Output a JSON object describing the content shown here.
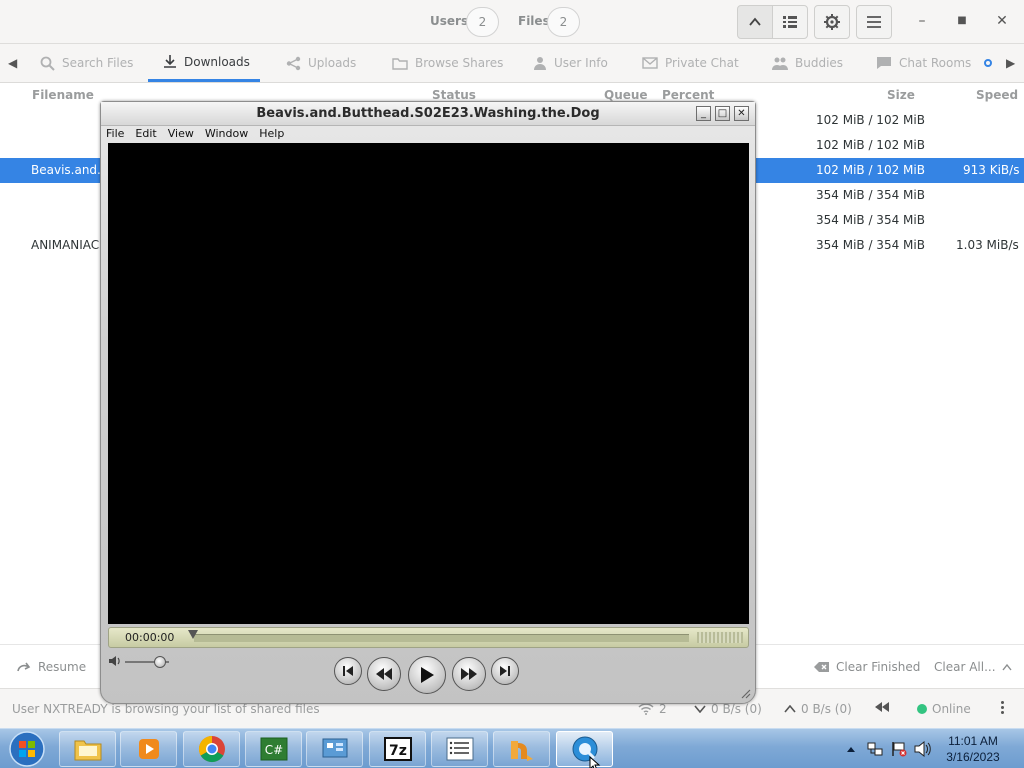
{
  "header": {
    "users_label": "Users",
    "users_count": "2",
    "files_label": "Files",
    "files_count": "2"
  },
  "tabs": [
    {
      "label": "Search Files",
      "icon": "search-icon"
    },
    {
      "label": "Downloads",
      "icon": "download-icon"
    },
    {
      "label": "Uploads",
      "icon": "share-icon"
    },
    {
      "label": "Browse Shares",
      "icon": "folder-icon"
    },
    {
      "label": "User Info",
      "icon": "user-icon"
    },
    {
      "label": "Private Chat",
      "icon": "mail-icon"
    },
    {
      "label": "Buddies",
      "icon": "people-icon"
    },
    {
      "label": "Chat Rooms",
      "icon": "chat-icon"
    }
  ],
  "columns": {
    "filename": "Filename",
    "status": "Status",
    "queue": "Queue",
    "percent": "Percent",
    "size": "Size",
    "speed": "Speed"
  },
  "transfers": [
    {
      "filename": "",
      "size": "102 MiB / 102 MiB",
      "speed": ""
    },
    {
      "filename": "",
      "size": "102 MiB / 102 MiB",
      "speed": ""
    },
    {
      "filename": "Beavis.and.Bu",
      "size": "102 MiB / 102 MiB",
      "speed": "913 KiB/s"
    },
    {
      "filename": "",
      "size": "354 MiB / 354 MiB",
      "speed": ""
    },
    {
      "filename": "",
      "size": "354 MiB / 354 MiB",
      "speed": ""
    },
    {
      "filename": "ANIMANIACS",
      "size": "354 MiB / 354 MiB",
      "speed": "1.03 MiB/s"
    }
  ],
  "bottom": {
    "resume": "Resume",
    "clear_finished": "Clear Finished",
    "clear_all": "Clear All..."
  },
  "status": {
    "message": "User NXTREADY is browsing your list of shared files",
    "connections": "2",
    "download_speed": "0 B/s (0)",
    "upload_speed": "0 B/s (0)",
    "online": "Online"
  },
  "player": {
    "title": "Beavis.and.Butthead.S02E23.Washing.the.Dog",
    "menu": [
      "File",
      "Edit",
      "View",
      "Window",
      "Help"
    ],
    "time": "00:00:00",
    "progress": 0.0,
    "volume": 0.8
  },
  "taskbar": {
    "apps": [
      "explorer-icon",
      "media-player-icon",
      "chrome-icon",
      "csharp-icon",
      "control-panel-icon",
      "7zip-icon",
      "list-app-icon",
      "nicotine-icon",
      "quicktime-icon"
    ],
    "time": "11:01 AM",
    "date": "3/16/2023"
  },
  "colors": {
    "accent": "#3584e4",
    "online": "#33c481"
  }
}
